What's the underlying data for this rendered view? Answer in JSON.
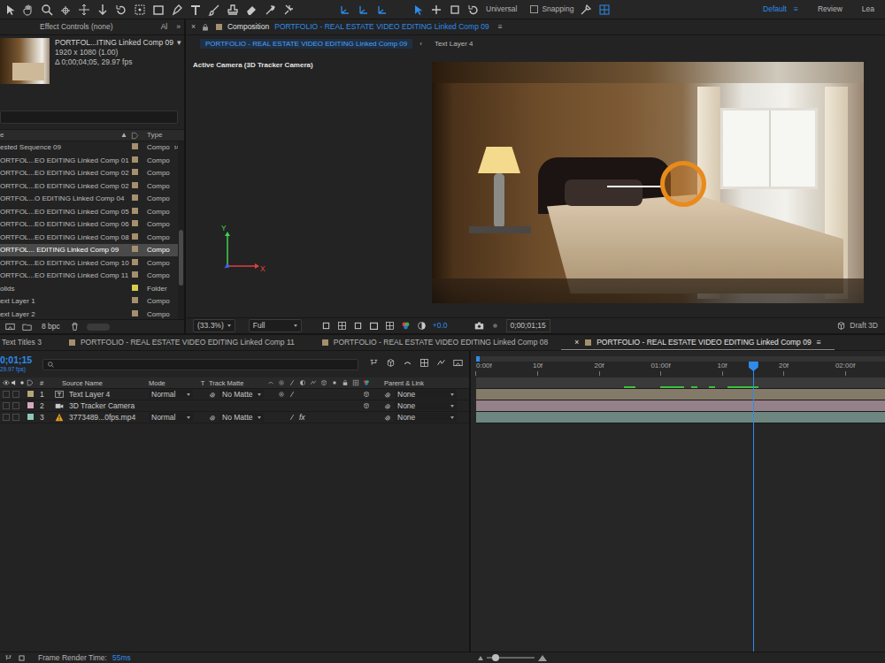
{
  "toolbar": {
    "mode": "Universal",
    "snapping": {
      "label": "Snapping",
      "checked": false
    },
    "workspaces": [
      {
        "label": "Default",
        "menu": "≡",
        "selected": true
      },
      {
        "label": "Review",
        "selected": false
      },
      {
        "label": "Lea",
        "selected": false
      }
    ]
  },
  "project": {
    "tabs": [
      {
        "label": "Effect Controls (none)"
      },
      {
        "label": "Al"
      }
    ],
    "overflow": "»",
    "preview": {
      "name": "PORTFOL...ITING Linked Comp 09",
      "arrow": "▾",
      "size": "1920 x 1080 (1.00)",
      "duration": "Δ 0;00;04;05, 29.97 fps"
    },
    "columns": {
      "name": "e",
      "sort": "▲",
      "type": "Type"
    },
    "items": [
      {
        "name": "ested Sequence 09",
        "type": "Compo",
        "kind": "nested",
        "color": "#a58f6d",
        "selected": false
      },
      {
        "name": "ORTFOL...EO EDITING Linked Comp 01",
        "type": "Compo",
        "kind": "comp",
        "color": "#a58f6d",
        "selected": false
      },
      {
        "name": "ORTFOL...EO EDITING Linked Comp 02",
        "type": "Compo",
        "kind": "comp",
        "color": "#a58f6d",
        "selected": false
      },
      {
        "name": "ORTFOL...EO EDITING Linked Comp 02",
        "type": "Compo",
        "kind": "comp",
        "color": "#a58f6d",
        "selected": false
      },
      {
        "name": "ORTFOL...O EDITING Linked Comp 04",
        "type": "Compo",
        "kind": "comp",
        "color": "#a58f6d",
        "selected": false
      },
      {
        "name": "ORTFOL...EO EDITING Linked Comp 05",
        "type": "Compo",
        "kind": "comp",
        "color": "#a58f6d",
        "selected": false
      },
      {
        "name": "ORTFOL...EO EDITING Linked Comp 06",
        "type": "Compo",
        "kind": "comp",
        "color": "#a58f6d",
        "selected": false
      },
      {
        "name": "ORTFOL...EO EDITING Linked Comp 08",
        "type": "Compo",
        "kind": "comp",
        "color": "#a58f6d",
        "selected": false
      },
      {
        "name": "ORTFOL... EDITING Linked Comp 09",
        "type": "Compo",
        "kind": "comp",
        "color": "#a58f6d",
        "selected": true
      },
      {
        "name": "ORTFOL...EO EDITING Linked Comp 10",
        "type": "Compo",
        "kind": "comp",
        "color": "#a58f6d",
        "selected": false
      },
      {
        "name": "ORTFOL...EO EDITING Linked Comp 11",
        "type": "Compo",
        "kind": "comp",
        "color": "#a58f6d",
        "selected": false
      },
      {
        "name": "olids",
        "type": "Folder",
        "kind": "folder",
        "color": "#d8cc48",
        "selected": false
      },
      {
        "name": "ext Layer 1",
        "type": "Compo",
        "kind": "comp",
        "color": "#a58f6d",
        "selected": false
      },
      {
        "name": "ext Layer 2",
        "type": "Compo",
        "kind": "comp",
        "color": "#a58f6d",
        "selected": false
      }
    ],
    "depth": "8 bpc"
  },
  "composition": {
    "close": "×",
    "title": "Composition",
    "comp": "PORTFOLIO - REAL ESTATE VIDEO EDITING Linked Comp 09",
    "menu": "≡",
    "tabs": [
      {
        "label": "PORTFOLIO - REAL ESTATE VIDEO EDITING Linked Comp 09",
        "selected": true
      },
      {
        "label": "Text Layer 4",
        "selected": false
      }
    ],
    "tab_arrow": "‹",
    "view_label": "Active Camera (3D Tracker Camera)",
    "axes": {
      "y": "Y",
      "x": "X"
    },
    "footer": {
      "zoom": "(33.3%)",
      "resolution": "Full",
      "exposure": "+0.0",
      "time": "0;00;01;15",
      "renderer": "Draft 3D"
    }
  },
  "timeline": {
    "close": "×",
    "menu": "≡",
    "tabs": [
      {
        "label": "Text Titles 3",
        "selected": false
      },
      {
        "label": "PORTFOLIO - REAL ESTATE VIDEO EDITING Linked Comp 11",
        "color": "#a58f6d",
        "selected": false
      },
      {
        "label": "PORTFOLIO - REAL ESTATE VIDEO EDITING Linked Comp 08",
        "color": "#a58f6d",
        "selected": false
      },
      {
        "label": "PORTFOLIO - REAL ESTATE VIDEO EDITING Linked Comp 09",
        "color": "#a58f6d",
        "selected": true
      }
    ],
    "time": "0;01;15",
    "fps": "29.97 fps)",
    "columns": [
      "#",
      "Source Name",
      "Mode",
      "T",
      "Track Matte",
      "Parent & Link"
    ],
    "layers": [
      {
        "num": "1",
        "name": "Text Layer 4",
        "kind": "text",
        "mode": "Normal",
        "matte": "No Matte",
        "parent": "None",
        "color": "#b8a479",
        "bar_color": "#837a69"
      },
      {
        "num": "2",
        "name": "3D Tracker Camera",
        "kind": "camera",
        "parent": "None",
        "color": "#d6a9bd",
        "bar_color": "#958189"
      },
      {
        "num": "3",
        "name": "3773489...0fps.mp4",
        "kind": "footage",
        "mode": "Normal",
        "matte": "No Matte",
        "parent": "None",
        "fx": "fx",
        "color": "#8fc6b9",
        "bar_color": "#6e8680"
      }
    ],
    "ruler": [
      "0:00f",
      "10f",
      "20f",
      "01:00f",
      "10f",
      "20f",
      "02:00f"
    ],
    "playhead": 0.677,
    "cached": [
      [
        0.361,
        0.39
      ],
      [
        0.45,
        0.509
      ],
      [
        0.526,
        0.541
      ],
      [
        0.569,
        0.584
      ],
      [
        0.615,
        0.69
      ]
    ]
  },
  "status": {
    "label": "Frame Render Time:",
    "value": "55ms"
  }
}
